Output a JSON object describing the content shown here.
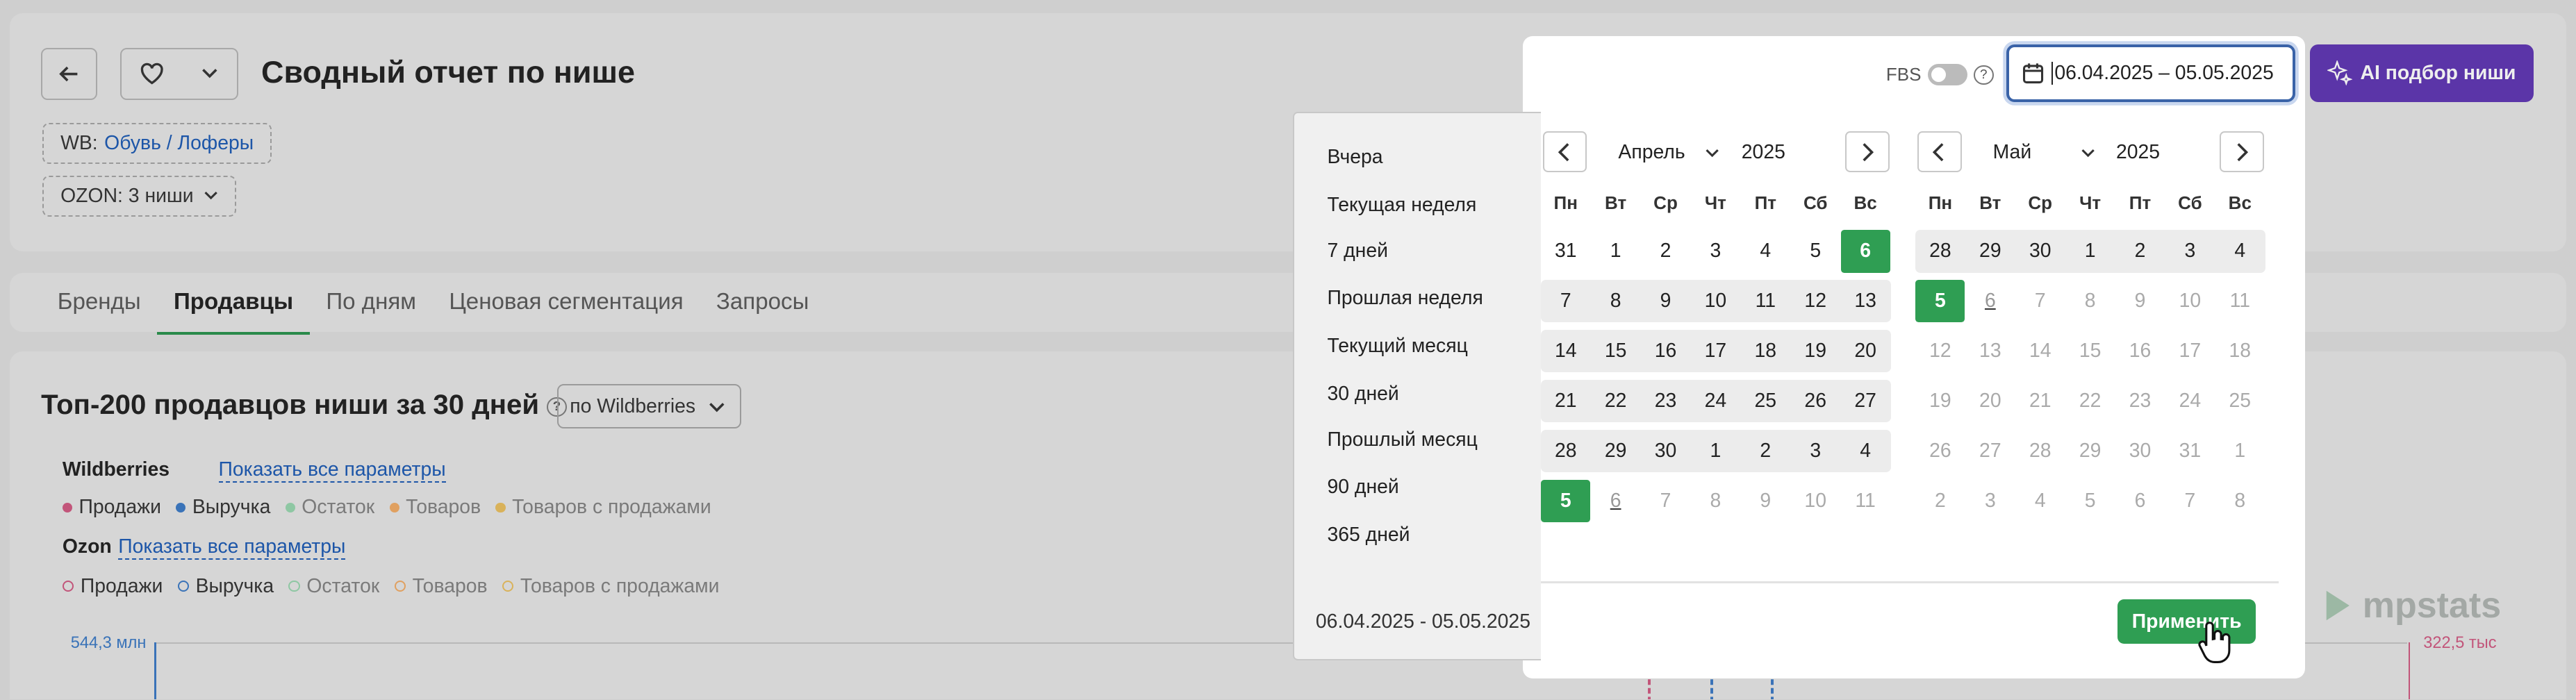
{
  "header": {
    "title": "Сводный отчет по нише",
    "wb_label": "WB:",
    "wb_link": "Обувь / Лоферы",
    "ozon_label": "OZON: 3 ниши"
  },
  "tabs": [
    "Бренды",
    "Продавцы",
    "По дням",
    "Ценовая сегментация",
    "Запросы"
  ],
  "section": {
    "title": "Топ-200 продавцов ниши за 30 дней",
    "select": "по Wildberries",
    "wb_label": "Wildberries",
    "wb_show": "Показать все параметры",
    "wb_legend": [
      {
        "label": "Продажи",
        "color": "#c2557a"
      },
      {
        "label": "Выручка",
        "color": "#3a73b8"
      },
      {
        "label": "Остаток",
        "color": "#8ec7a3"
      },
      {
        "label": "Товаров",
        "color": "#e0a060"
      },
      {
        "label": "Товаров с продажами",
        "color": "#d9b25a"
      }
    ],
    "ozon_label": "Ozon",
    "ozon_show": "Показать все параметры",
    "ozon_legend": [
      {
        "label": "Продажи",
        "color": "#c2557a"
      },
      {
        "label": "Выручка",
        "color": "#3a73b8"
      },
      {
        "label": "Остаток",
        "color": "#8ec7a3"
      },
      {
        "label": "Товаров",
        "color": "#e0a060"
      },
      {
        "label": "Товаров с продажами",
        "color": "#d9b25a"
      }
    ],
    "y_left": "544,3 млн",
    "y_right": "322,5 тыс"
  },
  "toolbar": {
    "fbs": "FBS",
    "date_range": "06.04.2025 – 05.05.2025",
    "ai_button": "AI подбор ниши"
  },
  "presets": {
    "items": [
      "Вчера",
      "Текущая неделя",
      "7 дней",
      "Прошлая неделя",
      "Текущий месяц",
      "30 дней",
      "Прошлый месяц",
      "90 дней",
      "365 дней"
    ],
    "range": "06.04.2025 - 05.05.2025"
  },
  "weekdays": [
    "Пн",
    "Вт",
    "Ср",
    "Чт",
    "Пт",
    "Сб",
    "Вс"
  ],
  "cal_left": {
    "month": "Апрель",
    "year": "2025",
    "rows": [
      [
        "31",
        "1",
        "2",
        "3",
        "4",
        "5",
        "6"
      ],
      [
        "7",
        "8",
        "9",
        "10",
        "11",
        "12",
        "13"
      ],
      [
        "14",
        "15",
        "16",
        "17",
        "18",
        "19",
        "20"
      ],
      [
        "21",
        "22",
        "23",
        "24",
        "25",
        "26",
        "27"
      ],
      [
        "28",
        "29",
        "30",
        "1",
        "2",
        "3",
        "4"
      ],
      [
        "5",
        "6",
        "7",
        "8",
        "9",
        "10",
        "11"
      ]
    ]
  },
  "cal_right": {
    "month": "Май",
    "year": "2025",
    "rows": [
      [
        "28",
        "29",
        "30",
        "1",
        "2",
        "3",
        "4"
      ],
      [
        "5",
        "6",
        "7",
        "8",
        "9",
        "10",
        "11"
      ],
      [
        "12",
        "13",
        "14",
        "15",
        "16",
        "17",
        "18"
      ],
      [
        "19",
        "20",
        "21",
        "22",
        "23",
        "24",
        "25"
      ],
      [
        "26",
        "27",
        "28",
        "29",
        "30",
        "31",
        "1"
      ],
      [
        "2",
        "3",
        "4",
        "5",
        "6",
        "7",
        "8"
      ]
    ]
  },
  "apply": "Применить",
  "brand": "mpstats"
}
